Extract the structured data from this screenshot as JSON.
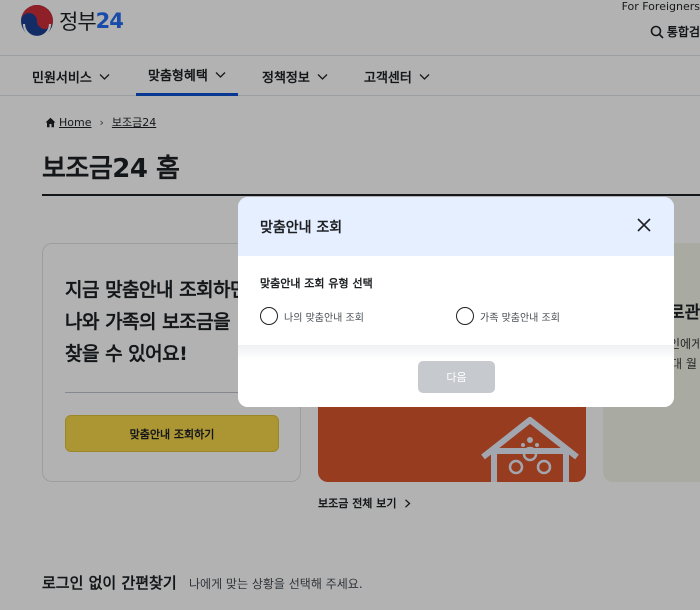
{
  "header": {
    "logo_text": "정부",
    "logo_num": "24",
    "for_foreigners": "For Foreigners",
    "search_label": "통합검"
  },
  "nav": {
    "items": [
      {
        "label": "민원서비스"
      },
      {
        "label": "맞춤형혜택",
        "active": true
      },
      {
        "label": "정책정보"
      },
      {
        "label": "고객센터"
      }
    ]
  },
  "breadcrumb": {
    "home": "Home",
    "current": "보조금24"
  },
  "page": {
    "title": "보조금24 홈"
  },
  "cards": {
    "left": {
      "headline_1": "지금 맞춤안내 조회하면",
      "headline_2": "나와 가족의 보조금을",
      "headline_3": "찾을 수 있어요!",
      "button": "맞춤안내 조회하기"
    },
    "right": {
      "title": "로관",
      "line_1": "인에게",
      "line_2": "대 월"
    }
  },
  "view_all": "보조금 전체 보기",
  "quick": {
    "title": "로그인 없이 간편찾기",
    "subtitle": "나에게 맞는 상황을 선택해 주세요."
  },
  "modal": {
    "title": "맞춤안내 조회",
    "subtitle": "맞춤안내 조회 유형 선택",
    "options": [
      {
        "label": "나의 맞춤안내 조회"
      },
      {
        "label": "가족 맞춤안내 조회"
      }
    ],
    "next_button": "다음"
  },
  "colors": {
    "brand_blue": "#256ef4",
    "nav_active": "#0b50d0",
    "cta_yellow": "#f6d74a",
    "card_orange": "#d8562c",
    "modal_header": "#e6efff"
  }
}
